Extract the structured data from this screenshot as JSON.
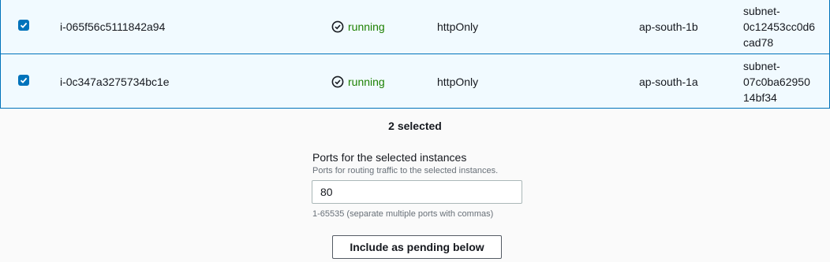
{
  "rows": [
    {
      "checked": true,
      "instance_id": "i-065f56c5111842a94",
      "state": "running",
      "protocol": "httpOnly",
      "zone": "ap-south-1b",
      "subnet_lines": [
        "subnet-",
        "0c12453cc0d6",
        "cad78"
      ]
    },
    {
      "checked": true,
      "instance_id": "i-0c347a3275734bc1e",
      "state": "running",
      "protocol": "httpOnly",
      "zone": "ap-south-1a",
      "subnet_lines": [
        "subnet-",
        "07c0ba62950",
        "14bf34"
      ]
    }
  ],
  "selection": {
    "count_text": "2 selected"
  },
  "ports_field": {
    "label": "Ports for the selected instances",
    "description": "Ports for routing traffic to the selected instances.",
    "value": "80",
    "constraint": "1-65535 (separate multiple ports with commas)"
  },
  "actions": {
    "include_pending_label": "Include as pending below"
  },
  "colors": {
    "accent": "#0073bb",
    "running": "#1d8102",
    "row_selected_bg": "#f1faff"
  }
}
